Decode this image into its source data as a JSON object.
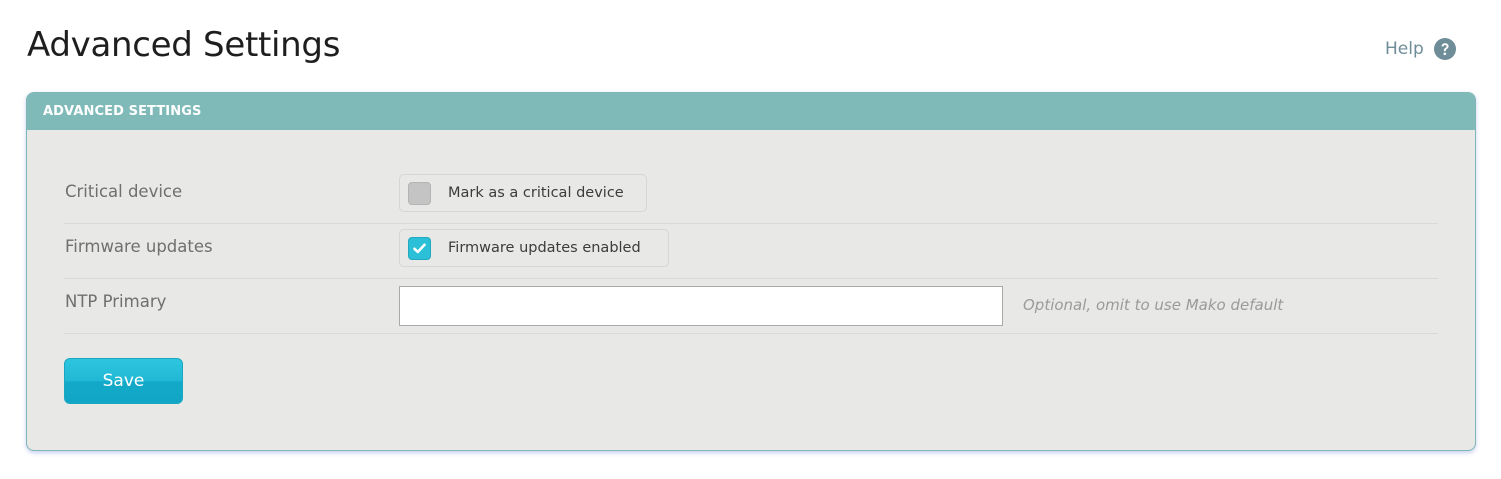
{
  "page": {
    "title": "Advanced Settings"
  },
  "help": {
    "label": "Help",
    "icon": "question-circle-icon"
  },
  "panel": {
    "header": "ADVANCED SETTINGS"
  },
  "form": {
    "critical_device": {
      "label": "Critical device",
      "checkbox_label": "Mark as a critical device",
      "checked": false
    },
    "firmware_updates": {
      "label": "Firmware updates",
      "checkbox_label": "Firmware updates enabled",
      "checked": true
    },
    "ntp_primary": {
      "label": "NTP Primary",
      "value": "",
      "hint": "Optional, omit to use Mako default"
    }
  },
  "actions": {
    "save_label": "Save"
  },
  "colors": {
    "accent": "#2bbfd8",
    "panel_header": "#7fbab9",
    "panel_background": "#e8e8e6",
    "help_text": "#6e8d98"
  }
}
